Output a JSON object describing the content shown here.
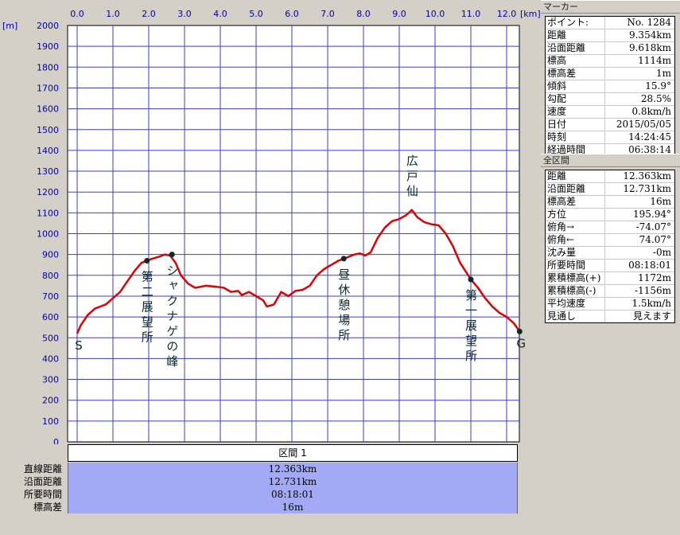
{
  "chart_data": {
    "type": "line",
    "xlabel": "[km]",
    "ylabel": "[m]",
    "xlim": [
      0,
      12.363
    ],
    "ylim": [
      0,
      2000
    ],
    "x_ticks": [
      "0.0",
      "1.0",
      "2.0",
      "3.0",
      "4.0",
      "5.0",
      "6.0",
      "7.0",
      "8.0",
      "9.0",
      "10.0",
      "11.0",
      "12.0"
    ],
    "y_ticks": [
      "0",
      "100",
      "200",
      "300",
      "400",
      "500",
      "600",
      "700",
      "800",
      "900",
      "1000",
      "1100",
      "1200",
      "1300",
      "1400",
      "1500",
      "1600",
      "1700",
      "1800",
      "1900",
      "2000"
    ],
    "grid": true,
    "color": "#e00000",
    "series": [
      {
        "x": [
          0.0,
          0.1,
          0.3,
          0.5,
          0.8,
          1.0,
          1.2,
          1.4,
          1.6,
          1.8,
          1.95,
          2.1,
          2.3,
          2.45,
          2.6,
          2.75,
          2.9,
          3.1,
          3.3,
          3.6,
          3.9,
          4.1,
          4.3,
          4.5,
          4.6,
          4.8,
          5.0,
          5.2,
          5.3,
          5.5,
          5.7,
          5.9,
          6.1,
          6.3,
          6.5,
          6.7,
          6.9,
          7.1,
          7.3,
          7.45,
          7.6,
          7.75,
          7.9,
          8.05,
          8.2,
          8.4,
          8.6,
          8.8,
          9.0,
          9.2,
          9.354,
          9.5,
          9.7,
          9.9,
          10.1,
          10.3,
          10.5,
          10.7,
          10.85,
          11.0,
          11.2,
          11.4,
          11.6,
          11.8,
          12.0,
          12.2,
          12.363
        ],
        "y": [
          520,
          560,
          610,
          640,
          660,
          690,
          720,
          770,
          820,
          860,
          870,
          880,
          890,
          900,
          895,
          860,
          800,
          760,
          740,
          750,
          745,
          740,
          720,
          725,
          705,
          720,
          700,
          680,
          650,
          660,
          720,
          700,
          725,
          730,
          750,
          800,
          830,
          850,
          870,
          880,
          890,
          900,
          905,
          895,
          910,
          980,
          1030,
          1060,
          1070,
          1090,
          1114,
          1080,
          1055,
          1045,
          1040,
          1000,
          940,
          860,
          820,
          780,
          740,
          690,
          650,
          620,
          600,
          570,
          530
        ]
      }
    ],
    "annotations": [
      {
        "label": "S",
        "x": 0.0,
        "y": 520,
        "marker": false
      },
      {
        "label": "第二展望所",
        "x": 1.95,
        "y": 870,
        "marker": true
      },
      {
        "label": "シャクナゲの峰",
        "x": 2.65,
        "y": 900,
        "marker": true
      },
      {
        "label": "昼休憩場所",
        "x": 7.45,
        "y": 880,
        "marker": true
      },
      {
        "label": "広戸仙",
        "x": 9.354,
        "y": 1114,
        "marker": false
      },
      {
        "label": "第一展望所",
        "x": 11.0,
        "y": 780,
        "marker": true
      },
      {
        "label": "G",
        "x": 12.363,
        "y": 530,
        "marker": true
      }
    ]
  },
  "summary": {
    "header": "区間 1",
    "rows": [
      {
        "label": "直線距離",
        "value": "12.363km"
      },
      {
        "label": "沿面距離",
        "value": "12.731km"
      },
      {
        "label": "所要時間",
        "value": "08:18:01"
      },
      {
        "label": "標高差",
        "value": "16m"
      }
    ]
  },
  "marker_panel": {
    "title": "マーカー",
    "rows": [
      {
        "label": "ポイント:",
        "value": "No. 1284"
      },
      {
        "label": "距離",
        "value": "9.354km"
      },
      {
        "label": "沿面距離",
        "value": "9.618km"
      },
      {
        "label": "標高",
        "value": "1114m"
      },
      {
        "label": "標高差",
        "value": "1m"
      },
      {
        "label": "傾斜",
        "value": "15.9°"
      },
      {
        "label": "勾配",
        "value": "28.5%"
      },
      {
        "label": "速度",
        "value": "0.8km/h"
      },
      {
        "label": "日付",
        "value": "2015/05/05"
      },
      {
        "label": "時刻",
        "value": "14:24:45"
      },
      {
        "label": "経過時間",
        "value": "06:38:14"
      }
    ]
  },
  "section_panel": {
    "title": "全区間",
    "rows": [
      {
        "label": "距離",
        "value": "12.363km"
      },
      {
        "label": "沿面距離",
        "value": "12.731km"
      },
      {
        "label": "標高差",
        "value": "16m"
      },
      {
        "label": "方位",
        "value": "195.94°"
      },
      {
        "label": "俯角→",
        "value": "-74.07°"
      },
      {
        "label": "俯角←",
        "value": "74.07°"
      },
      {
        "label": "沈み量",
        "value": "-0m"
      },
      {
        "label": "所要時間",
        "value": "08:18:01"
      },
      {
        "label": "累積標高(+)",
        "value": "1172m"
      },
      {
        "label": "累積標高(-)",
        "value": "-1156m"
      },
      {
        "label": "平均速度",
        "value": "1.5km/h"
      },
      {
        "label": "見通し",
        "value": "見えます"
      }
    ]
  }
}
